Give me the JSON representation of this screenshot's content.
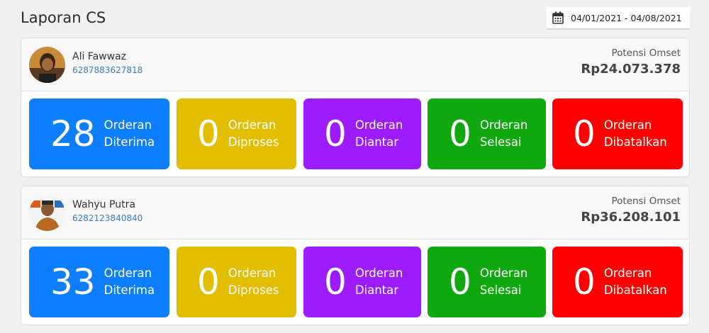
{
  "page": {
    "title": "Laporan CS"
  },
  "date_range": {
    "value": "04/01/2021 - 04/08/2021",
    "icon": "calendar-icon"
  },
  "cards": [
    {
      "name": "Ali Fawwaz",
      "phone": "6287883627818",
      "omset_label": "Potensi Omset",
      "omset_value": "Rp24.073.378",
      "stats": [
        {
          "count": "28",
          "line1": "Orderan",
          "line2": "Diterima",
          "color": "#0d7eff"
        },
        {
          "count": "0",
          "line1": "Orderan",
          "line2": "Diproses",
          "color": "#e3bd00"
        },
        {
          "count": "0",
          "line1": "Orderan",
          "line2": "Diantar",
          "color": "#9c1cff"
        },
        {
          "count": "0",
          "line1": "Orderan",
          "line2": "Selesai",
          "color": "#0fa80f"
        },
        {
          "count": "0",
          "line1": "Orderan",
          "line2": "Dibatalkan",
          "color": "#ff0000"
        }
      ]
    },
    {
      "name": "Wahyu Putra",
      "phone": "6282123840840",
      "omset_label": "Potensi Omset",
      "omset_value": "Rp36.208.101",
      "stats": [
        {
          "count": "33",
          "line1": "Orderan",
          "line2": "Diterima",
          "color": "#0d7eff"
        },
        {
          "count": "0",
          "line1": "Orderan",
          "line2": "Diproses",
          "color": "#e3bd00"
        },
        {
          "count": "0",
          "line1": "Orderan",
          "line2": "Diantar",
          "color": "#9c1cff"
        },
        {
          "count": "0",
          "line1": "Orderan",
          "line2": "Selesai",
          "color": "#0fa80f"
        },
        {
          "count": "0",
          "line1": "Orderan",
          "line2": "Dibatalkan",
          "color": "#ff0000"
        }
      ]
    }
  ]
}
